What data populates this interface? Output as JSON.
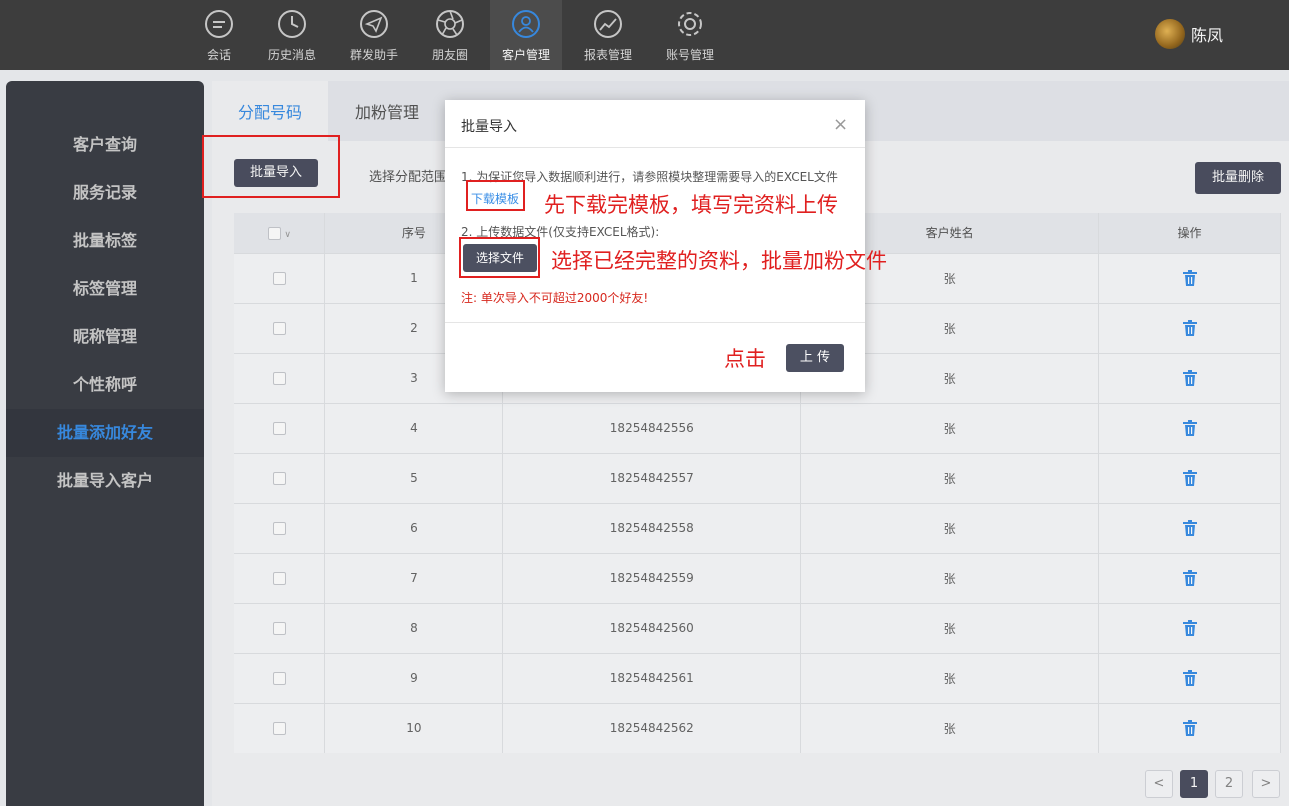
{
  "topnav": {
    "items": [
      {
        "label": "会话",
        "icon": "chat-icon"
      },
      {
        "label": "历史消息",
        "icon": "clock-icon"
      },
      {
        "label": "群发助手",
        "icon": "paper-plane-icon"
      },
      {
        "label": "朋友圈",
        "icon": "aperture-icon"
      },
      {
        "label": "客户管理",
        "icon": "user-icon"
      },
      {
        "label": "报表管理",
        "icon": "chart-icon"
      },
      {
        "label": "账号管理",
        "icon": "gear-icon"
      }
    ],
    "active_index": 4,
    "user_name": "陈凤"
  },
  "sidebar": {
    "items": [
      "客户查询",
      "服务记录",
      "批量标签",
      "标签管理",
      "昵称管理",
      "个性称呼",
      "批量添加好友",
      "批量导入客户"
    ],
    "active_index": 6
  },
  "tabs": [
    "分配号码",
    "加粉管理"
  ],
  "toolbar": {
    "batch_import": "批量导入",
    "range_label": "选择分配范围",
    "batch_delete": "批量删除"
  },
  "table": {
    "headers": [
      "",
      "序号",
      "",
      "客户姓名",
      "操作"
    ],
    "rows": [
      {
        "no": "1",
        "phone": "",
        "name": "张"
      },
      {
        "no": "2",
        "phone": "",
        "name": "张"
      },
      {
        "no": "3",
        "phone": "",
        "name": "张"
      },
      {
        "no": "4",
        "phone": "18254842556",
        "name": "张"
      },
      {
        "no": "5",
        "phone": "18254842557",
        "name": "张"
      },
      {
        "no": "6",
        "phone": "18254842558",
        "name": "张"
      },
      {
        "no": "7",
        "phone": "18254842559",
        "name": "张"
      },
      {
        "no": "8",
        "phone": "18254842560",
        "name": "张"
      },
      {
        "no": "9",
        "phone": "18254842561",
        "name": "张"
      },
      {
        "no": "10",
        "phone": "18254842562",
        "name": "张"
      }
    ]
  },
  "pagination": {
    "prev": "<",
    "pages": [
      "1",
      "2"
    ],
    "current": "1",
    "next": ">"
  },
  "modal": {
    "title": "批量导入",
    "close": "×",
    "line1": "1. 为保证您导入数据顺利进行，请参照模块整理需要导入的EXCEL文件",
    "download_link": "下载模板",
    "line2": "2. 上传数据文件(仅支持EXCEL格式):",
    "choose_file": "选择文件",
    "note": "注: 单次导入不可超过2000个好友!",
    "upload": "上 传"
  },
  "annotations": {
    "download_hint": "先下载完模板，填写完资料上传",
    "choose_hint": "选择已经完整的资料，批量加粉文件",
    "click_hint": "点击"
  },
  "colors": {
    "accent": "#3a8ee6",
    "dark_button": "#4c5061",
    "annotation": "#e02020",
    "topbar": "#404040",
    "sidebar": "#3c3f46"
  }
}
